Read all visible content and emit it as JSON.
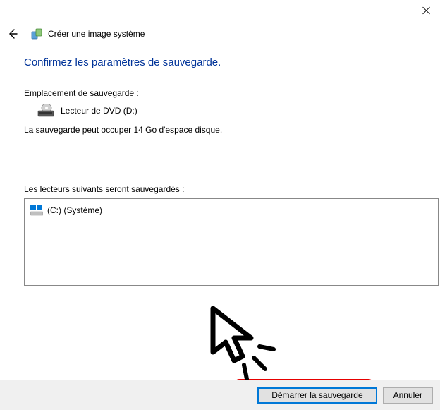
{
  "window": {
    "title": "Créer une image système"
  },
  "page": {
    "heading": "Confirmez les paramètres de sauvegarde.",
    "location_label": "Emplacement de sauvegarde :",
    "location_value": "Lecteur de DVD (D:)",
    "size_line": "La sauvegarde peut occuper 14 Go d'espace disque.",
    "drives_label": "Les lecteurs suivants seront sauvegardés :",
    "drives": [
      {
        "label": "(C:) (Système)"
      }
    ]
  },
  "buttons": {
    "start": "Démarrer la sauvegarde",
    "cancel": "Annuler"
  }
}
